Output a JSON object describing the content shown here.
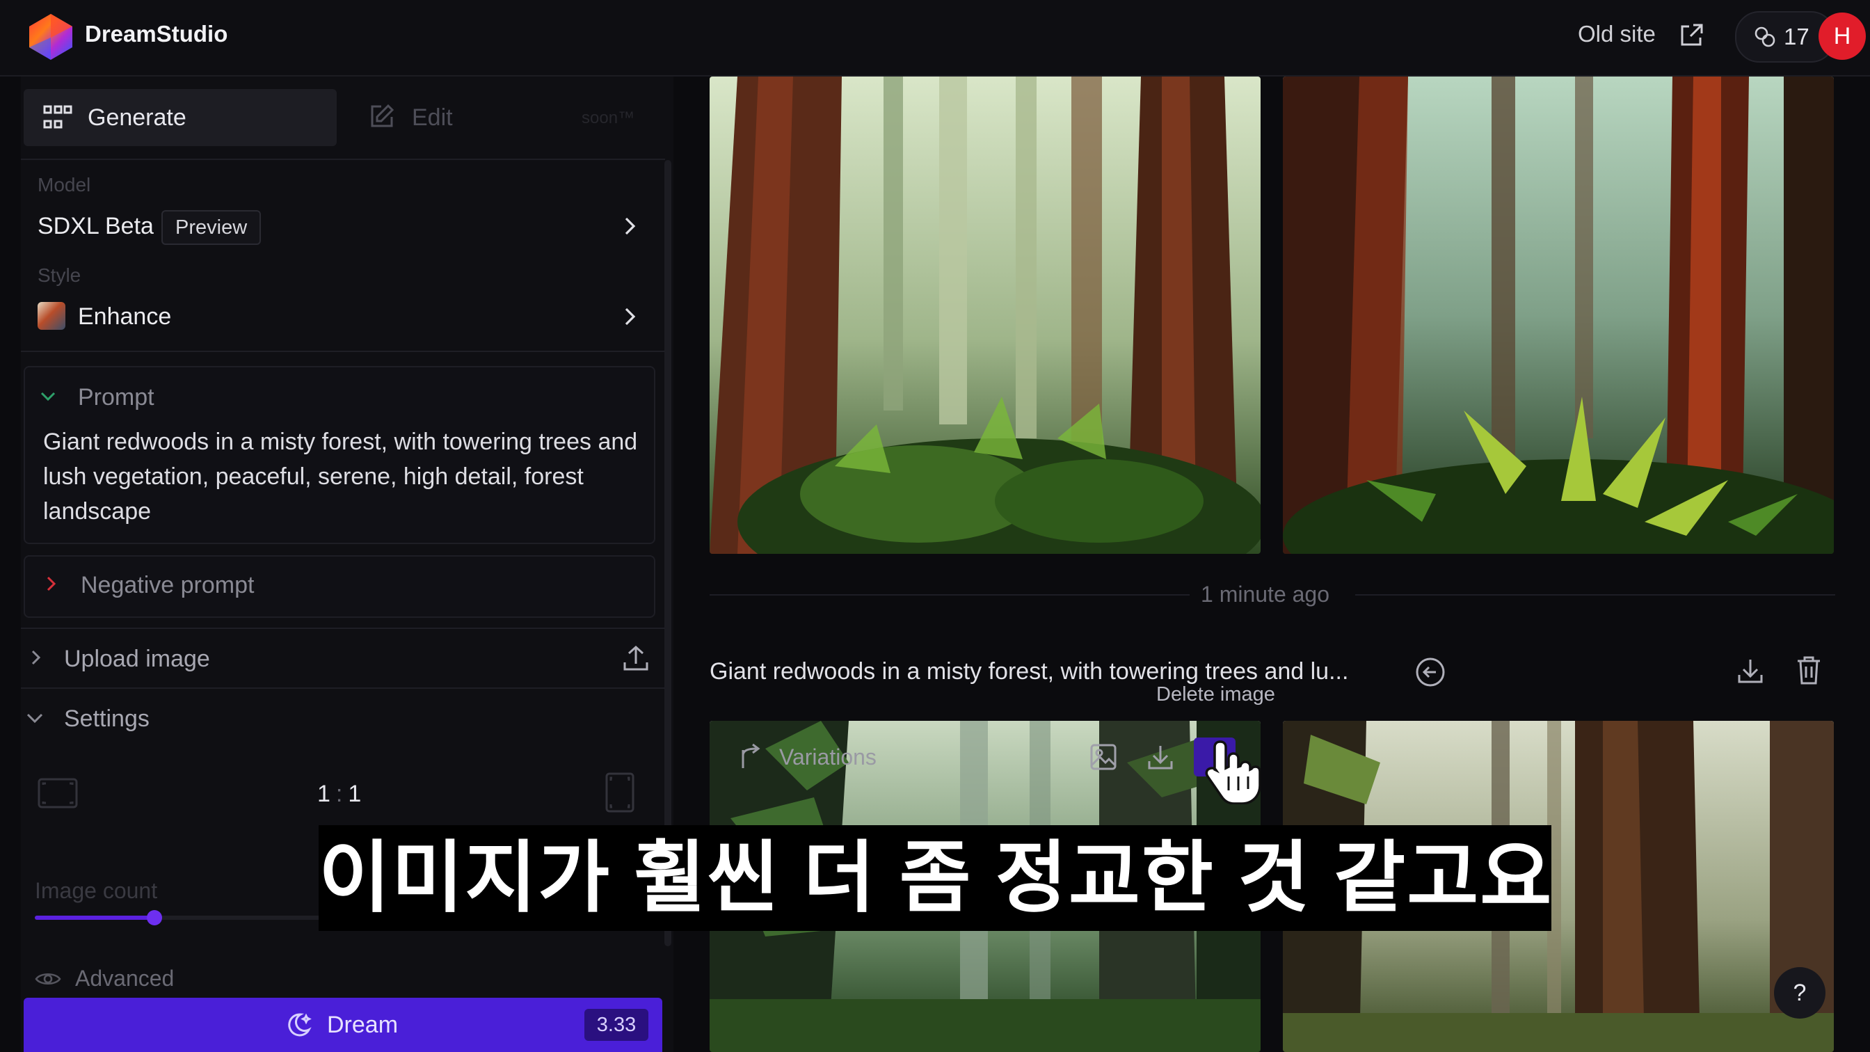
{
  "app": {
    "brand": "DreamStudio"
  },
  "header": {
    "old_site_label": "Old site",
    "credits": "17",
    "avatar_initial": "H"
  },
  "tabs": {
    "generate": "Generate",
    "edit": "Edit",
    "soon": "soon™"
  },
  "model": {
    "label": "Model",
    "value": "SDXL Beta",
    "badge": "Preview"
  },
  "style": {
    "label": "Style",
    "value": "Enhance"
  },
  "prompt": {
    "title": "Prompt",
    "text": "Giant redwoods in a misty forest, with towering trees and lush vegetation, peaceful, serene, high detail, forest landscape"
  },
  "negative_prompt": {
    "title": "Negative prompt"
  },
  "upload": {
    "title": "Upload image"
  },
  "settings": {
    "title": "Settings",
    "ratio_w": "1",
    "ratio_sep": ":",
    "ratio_h": "1"
  },
  "image_count": {
    "label": "Image count",
    "fraction": 0.4
  },
  "advanced": {
    "label": "Advanced"
  },
  "dream": {
    "label": "Dream",
    "cost": "3.33"
  },
  "gallery": {
    "timestamp": "1 minute ago",
    "generation_prompt": "Giant redwoods in a misty forest, with towering trees and lu...",
    "tooltip": "Delete image",
    "variations_label": "Variations"
  },
  "subtitle": "이미지가 훨씬 더 좀 정교한 것 같고요",
  "help": "?",
  "colors": {
    "accent": "#4a1fd8",
    "avatar": "#e11d2a",
    "background": "#0b0b0e"
  }
}
